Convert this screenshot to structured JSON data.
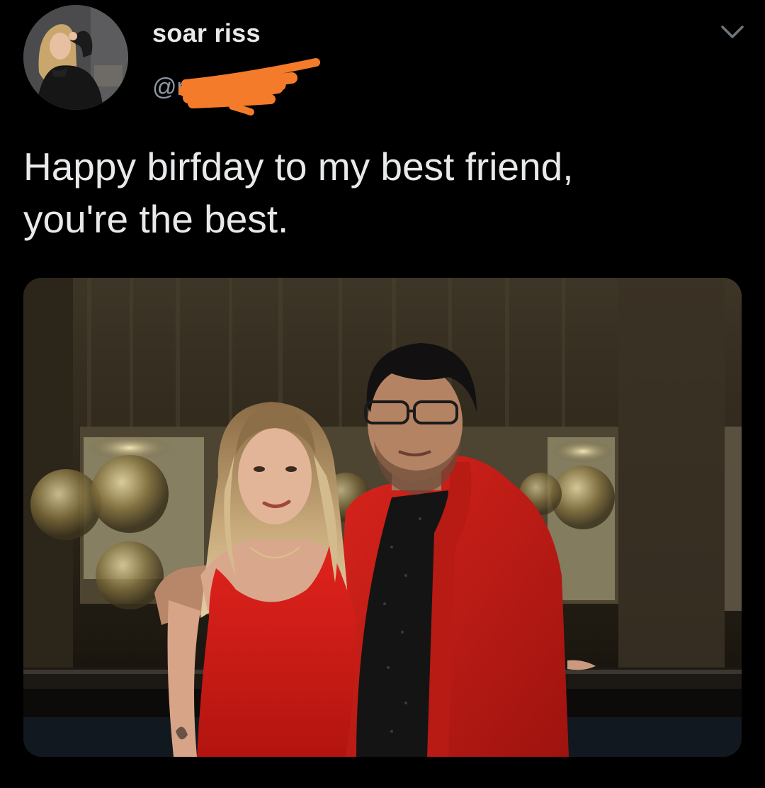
{
  "tweet": {
    "author": {
      "display_name": "soar riss",
      "handle": "@m"
    },
    "text": "Happy birfday to my best friend,\nyou're the best.",
    "menu_icon": "chevron-down-icon",
    "colors": {
      "background": "#000000",
      "text": "#e7e9ea",
      "secondary_text": "#8b98a5",
      "redaction_scribble": "#f47b2a"
    }
  }
}
